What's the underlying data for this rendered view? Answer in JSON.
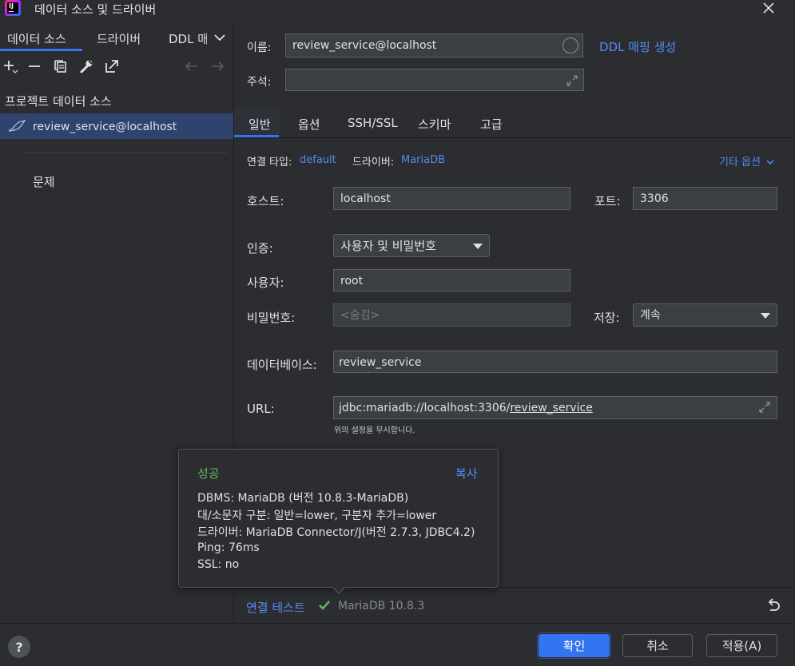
{
  "window": {
    "title": "데이터 소스 및 드라이버",
    "close_icon": "close-icon"
  },
  "left_panel": {
    "tabs": [
      "데이터 소스",
      "드라이버",
      "DDL 매"
    ],
    "project_header": "프로젝트 데이터 소스",
    "data_sources": [
      {
        "name": "review_service@localhost",
        "icon": "mariadb-seal-icon",
        "selected": true
      }
    ],
    "problems_label": "문제"
  },
  "form": {
    "name_label": "이름:",
    "name_value": "review_service@localhost",
    "ddl_mapping_link": "DDL 매핑 생성",
    "comment_label": "주석:",
    "comment_value": "",
    "tabs": [
      "일반",
      "옵션",
      "SSH/SSL",
      "스키마",
      "고급"
    ],
    "active_tab": "일반",
    "connection_type_label": "연결 타입:",
    "connection_type_value": "default",
    "driver_label": "드라이버:",
    "driver_value": "MariaDB",
    "more_options": "기타 옵션",
    "host_label": "호스트:",
    "host_value": "localhost",
    "port_label": "포트:",
    "port_value": "3306",
    "auth_label": "인증:",
    "auth_value": "사용자 및 비밀번호",
    "user_label": "사용자:",
    "user_value": "root",
    "password_label": "비밀번호:",
    "password_placeholder": "<숨김>",
    "save_label": "저장:",
    "save_value": "계속",
    "database_label": "데이터베이스:",
    "database_value": "review_service",
    "url_label": "URL:",
    "url_prefix": "jdbc:mariadb://localhost:3306/",
    "url_db": "review_service",
    "url_hint": "위의 설정을 무시합니다."
  },
  "tooltip": {
    "status": "성공",
    "copy": "복사",
    "lines": [
      "DBMS: MariaDB (버전 10.8.3-MariaDB)",
      "대/소문자 구분: 일반=lower, 구분자 추가=lower",
      "드라이버: MariaDB Connector/J(버전 2.7.3, JDBC4.2)",
      "Ping: 76ms",
      "SSL: no"
    ]
  },
  "status_bar": {
    "test_connection": "연결 테스트",
    "result": "MariaDB 10.8.3"
  },
  "footer": {
    "help": "?",
    "ok": "확인",
    "cancel": "취소",
    "apply": "적용(A)"
  },
  "colors": {
    "accent": "#3574f0",
    "link": "#548af7",
    "success": "#5fb865",
    "selected_row": "#2e436e"
  }
}
